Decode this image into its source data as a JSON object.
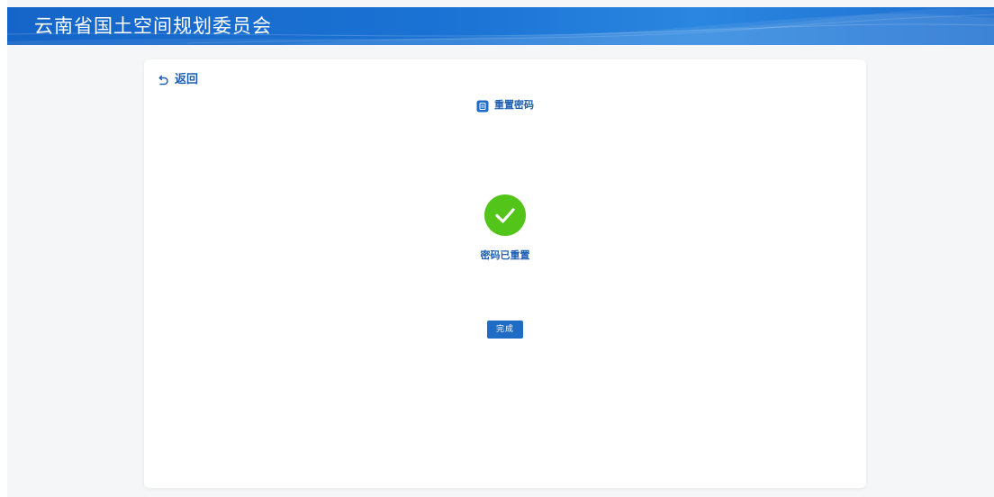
{
  "header": {
    "title": "云南省国土空间规划委员会"
  },
  "card": {
    "back_label": "返回",
    "section_title": "重置密码",
    "success_message": "密码已重置",
    "done_label": "完成"
  },
  "colors": {
    "header_blue": "#1565c8",
    "accent_blue": "#1e5fb3",
    "success_green": "#52c41a",
    "button_blue": "#1f6cc4",
    "page_background": "#f5f6f8"
  },
  "icons": {
    "back": "undo-arrow-icon",
    "section": "document-icon",
    "success": "check-circle-icon"
  }
}
